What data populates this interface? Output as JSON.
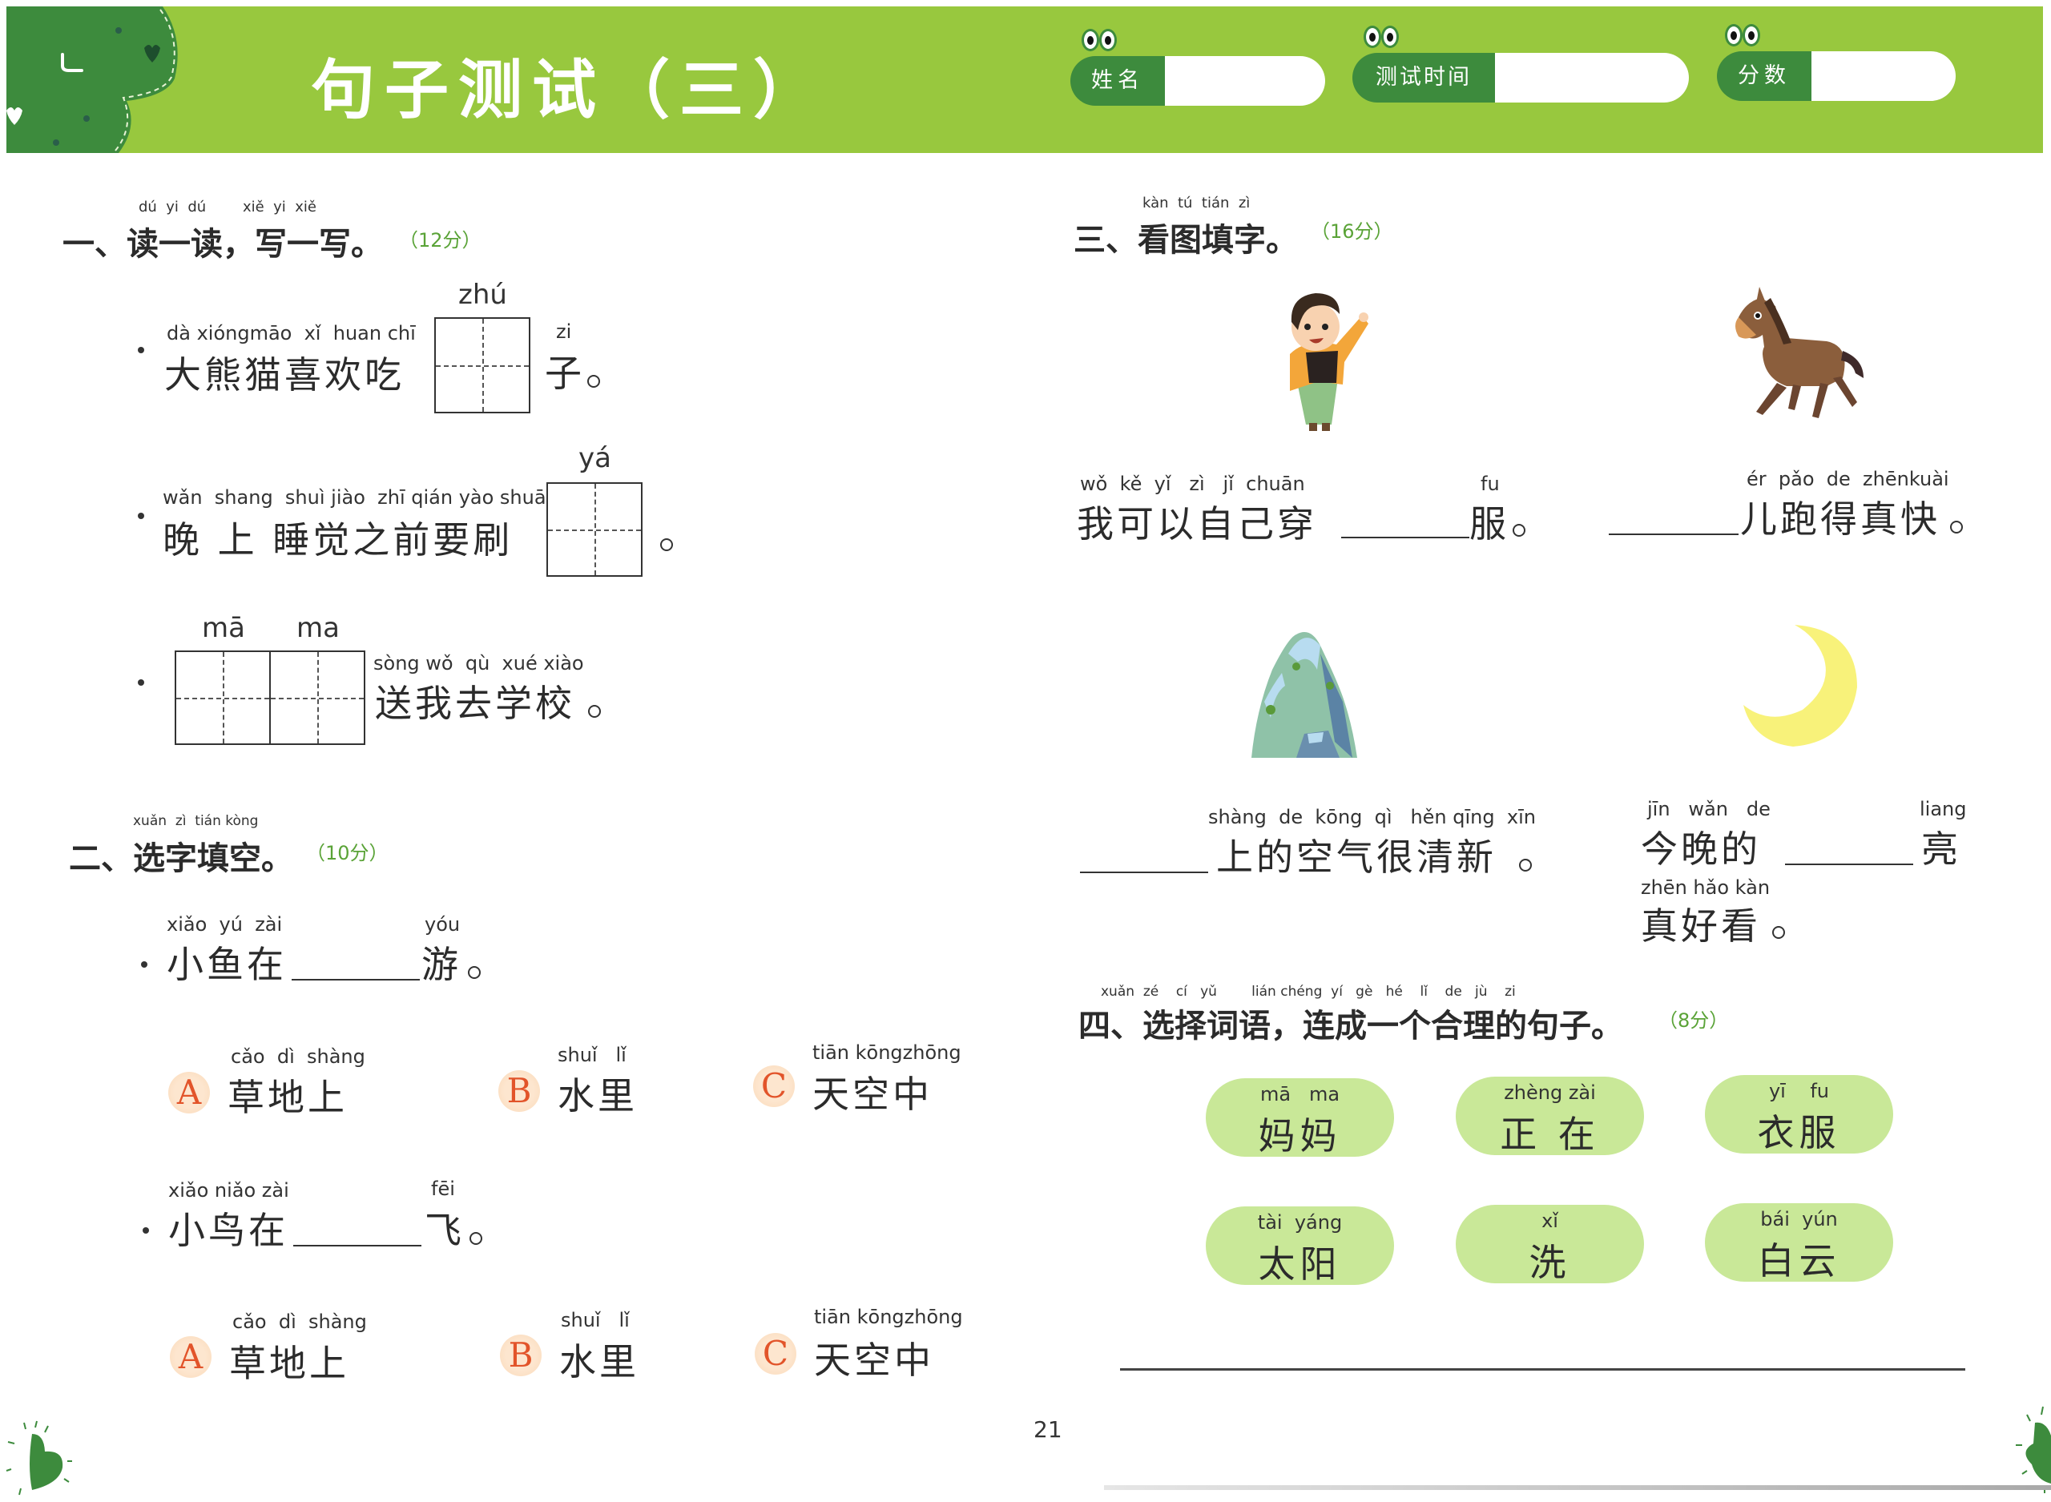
{
  "header": {
    "title": "句子测试（三）",
    "fields": [
      {
        "label": "姓名",
        "value": ""
      },
      {
        "label": "测试时间",
        "value": ""
      },
      {
        "label": "分数",
        "value": ""
      }
    ]
  },
  "section1": {
    "pinyin": "dú  yi  dú        xiě  yi  xiě",
    "title": "一、读一读，写一写。",
    "points": "（12分）",
    "items": [
      {
        "pinyin_before": "dà xióngmāo  xǐ  huan chī",
        "text_before": "大熊猫喜欢吃",
        "box_pinyin": "zhú",
        "pinyin_after": "zi",
        "text_after": "子"
      },
      {
        "pinyin_before": "wǎn  shang  shuì jiào  zhī qián yào shuā",
        "text_before": "晚 上 睡觉之前要刷",
        "box_pinyin": "yá",
        "pinyin_after": "",
        "text_after": ""
      },
      {
        "box_pinyin": [
          "mā",
          "ma"
        ],
        "pinyin_after": "sòng wǒ  qù  xué xiào",
        "text_after": "送我去学校"
      }
    ]
  },
  "section2": {
    "pinyin": "xuǎn  zì  tián kòng",
    "title": "二、选字填空。",
    "points": "（10分）",
    "questions": [
      {
        "pinyin_before": "xiǎo  yú  zài",
        "text_before": "小鱼在",
        "pinyin_after": "yóu",
        "text_after": "游"
      },
      {
        "pinyin_before": "xiǎo niǎo zài",
        "text_before": "小鸟在",
        "pinyin_after": "fēi",
        "text_after": "飞"
      }
    ],
    "options": [
      {
        "letter": "A",
        "pinyin": "cǎo  dì  shàng",
        "text": "草地上"
      },
      {
        "letter": "B",
        "pinyin": "shuǐ   lǐ",
        "text": "水里"
      },
      {
        "letter": "C",
        "pinyin": "tiān kōngzhōng",
        "text": "天空中"
      }
    ]
  },
  "section3": {
    "pinyin": "kàn  tú  tián  zì",
    "title": "三、看图填字。",
    "points": "（16分）",
    "pictures": [
      "boy-icon",
      "horse-icon",
      "mountain-icon",
      "moon-icon"
    ],
    "sentences": [
      {
        "pinyin_before": "wǒ  kě  yǐ   zì   jǐ  chuān",
        "text_before": "我可以自己穿",
        "pinyin_after": "fu",
        "text_after": "服"
      },
      {
        "pinyin_after": "ér  pǎo  de  zhēnkuài",
        "text_after": "儿跑得真快"
      },
      {
        "pinyin_after": "shàng  de  kōng  qì   hěn qīng  xīn",
        "text_after": "上的空气很清新"
      },
      {
        "pinyin_before": "jīn   wǎn   de",
        "text_before": "今晚的",
        "pinyin_after": "liang",
        "text_after": "亮",
        "pinyin_line2": "zhēn hǎo kàn",
        "text_line2": "真好看"
      }
    ]
  },
  "section4": {
    "pinyin": "xuǎn  zé    cí   yǔ        lián chéng  yí   gè   hé    lǐ    de   jù    zi",
    "title": "四、选择词语，连成一个合理的句子。",
    "points": "（8分）",
    "words": [
      {
        "pinyin": "mā   ma",
        "text": "妈妈"
      },
      {
        "pinyin": "zhèng zài",
        "text": "正 在"
      },
      {
        "pinyin": "yī    fu",
        "text": "衣服"
      },
      {
        "pinyin": "tài  yáng",
        "text": "太阳"
      },
      {
        "pinyin": "xǐ",
        "text": "洗"
      },
      {
        "pinyin": "bái  yún",
        "text": "白云"
      }
    ],
    "answer": ""
  },
  "footer": {
    "page_number": "21"
  },
  "colors": {
    "header_green": "#98c83e",
    "dark_green": "#3d8b3d",
    "card_green": "#c9e898",
    "points_green": "#5aa337",
    "option_red": "#e2542a"
  }
}
